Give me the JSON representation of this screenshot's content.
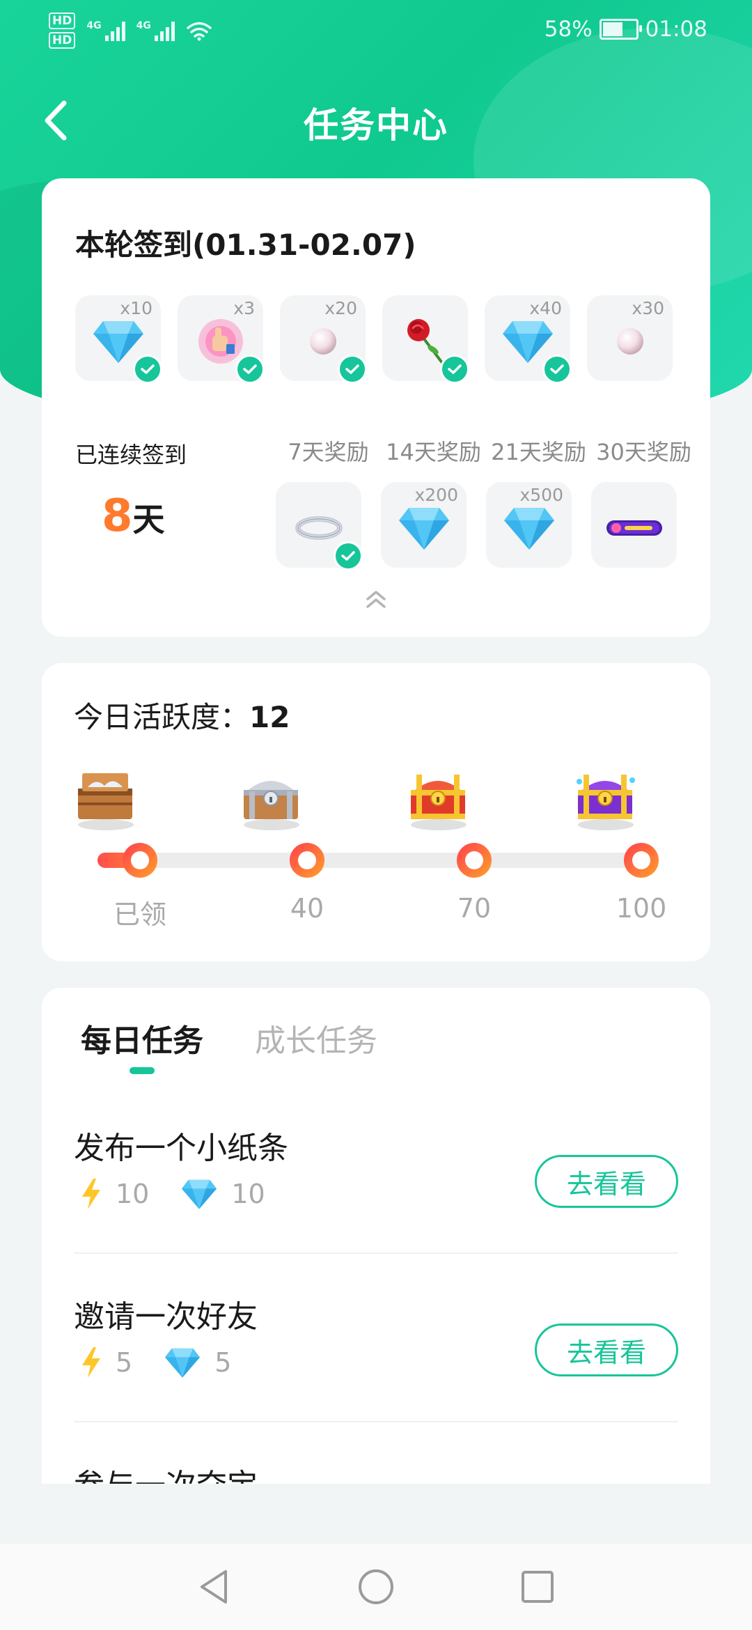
{
  "status_bar": {
    "hd1": "HD",
    "hd2": "HD",
    "net1": "4G",
    "net2": "4G",
    "battery": "58%",
    "time": "01:08"
  },
  "header": {
    "title": "任务中心"
  },
  "signin": {
    "title": "本轮签到(01.31-02.07)",
    "days": [
      {
        "qty": "x10",
        "icon": "diamond-icon",
        "checked": true
      },
      {
        "qty": "x3",
        "icon": "like-gift-icon",
        "checked": true
      },
      {
        "qty": "x20",
        "icon": "pearl-icon",
        "checked": true
      },
      {
        "qty": "",
        "icon": "rose-icon",
        "checked": true
      },
      {
        "qty": "x40",
        "icon": "diamond-icon",
        "checked": true
      },
      {
        "qty": "x30",
        "icon": "pearl-icon",
        "checked": false
      }
    ],
    "streak_label": "已连续签到",
    "streak_days": "8",
    "streak_unit": "天",
    "rewards": [
      {
        "label": "7天奖励",
        "qty": "",
        "icon": "ring-icon",
        "checked": true
      },
      {
        "label": "14天奖励",
        "qty": "x200",
        "icon": "diamond-icon",
        "checked": false
      },
      {
        "label": "21天奖励",
        "qty": "x500",
        "icon": "diamond-icon",
        "checked": false
      },
      {
        "label": "30天奖励",
        "qty": "",
        "icon": "badge-icon",
        "checked": false
      }
    ]
  },
  "activity": {
    "title_prefix": "今日活跃度：",
    "value": "12",
    "progress": 0.12,
    "milestones": [
      {
        "label": "已领",
        "chest": "wooden-chest-icon"
      },
      {
        "label": "40",
        "chest": "silver-chest-icon"
      },
      {
        "label": "70",
        "chest": "red-gold-chest-icon"
      },
      {
        "label": "100",
        "chest": "purple-gold-chest-icon"
      }
    ]
  },
  "tasks": {
    "tabs": [
      "每日任务",
      "成长任务"
    ],
    "active_tab": 0,
    "items": [
      {
        "name": "发布一个小纸条",
        "energy": "10",
        "diamonds": "10",
        "button": "去看看"
      },
      {
        "name": "邀请一次好友",
        "energy": "5",
        "diamonds": "5",
        "button": "去看看"
      },
      {
        "name": "参与一次夺宝",
        "energy": "",
        "diamonds": "",
        "button": ""
      }
    ]
  },
  "colors": {
    "accent": "#17c59a",
    "streak": "#ff7a2d"
  }
}
